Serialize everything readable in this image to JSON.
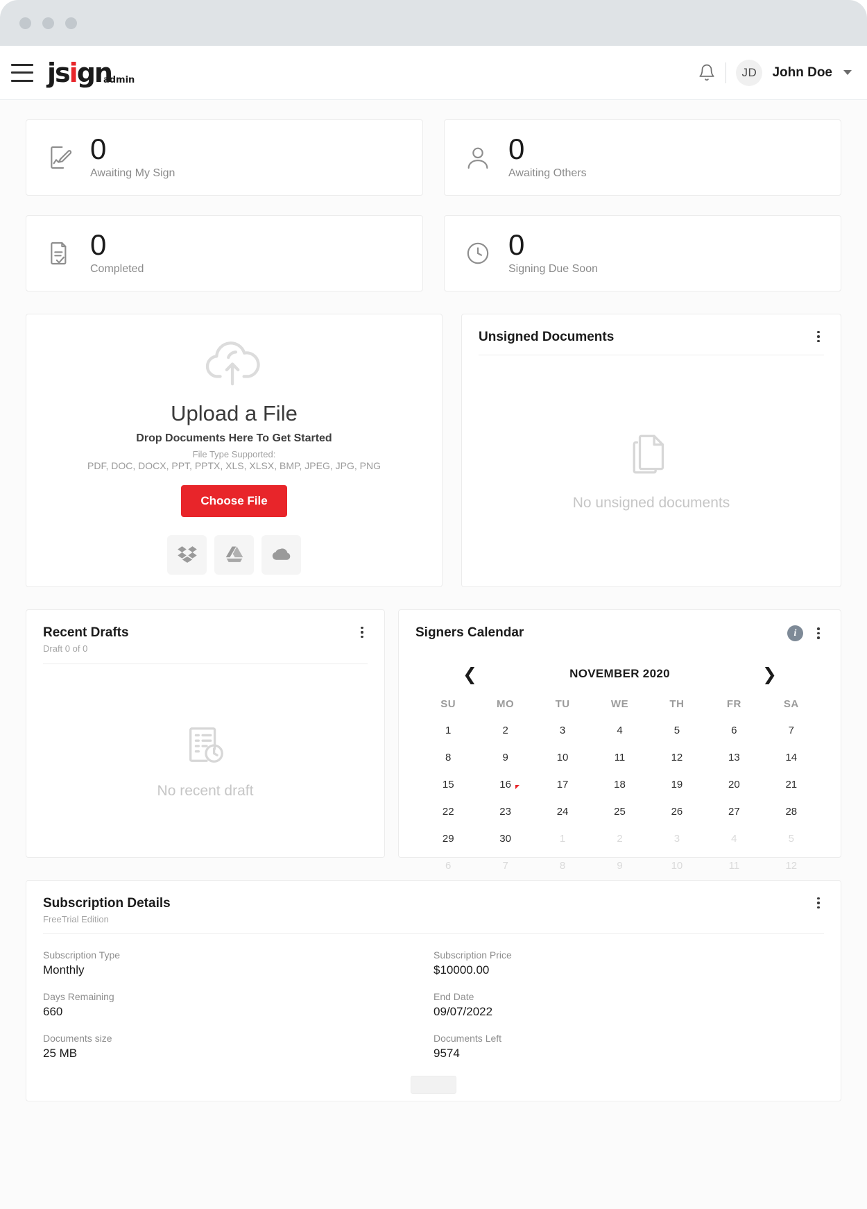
{
  "titlebar": {
    "dots": 3
  },
  "header": {
    "menu_icon": "hamburger-icon",
    "logo": {
      "part1": "js",
      "part2": "i",
      "part3": "gn",
      "suffix": "admin"
    },
    "bell_icon": "notification-bell-icon",
    "avatar_initials": "JD",
    "username": "John Doe",
    "caret_icon": "chevron-down-icon"
  },
  "stats": [
    {
      "icon": "document-sign-icon",
      "value": "0",
      "label": "Awaiting My Sign"
    },
    {
      "icon": "person-icon",
      "value": "0",
      "label": "Awaiting Others"
    },
    {
      "icon": "document-check-icon",
      "value": "0",
      "label": "Completed"
    },
    {
      "icon": "clock-icon",
      "value": "0",
      "label": "Signing Due Soon"
    }
  ],
  "upload": {
    "icon": "cloud-upload-icon",
    "title": "Upload a File",
    "subtitle": "Drop Documents Here To Get Started",
    "filetype_label": "File Type Supported:",
    "filetypes": "PDF, DOC, DOCX, PPT, PPTX, XLS, XLSX, BMP, JPEG, JPG, PNG",
    "button": "Choose File",
    "cloud_services": [
      {
        "name": "dropbox-icon",
        "label": "Dropbox"
      },
      {
        "name": "google-drive-icon",
        "label": "Google Drive"
      },
      {
        "name": "onedrive-icon",
        "label": "OneDrive"
      }
    ]
  },
  "unsigned": {
    "title": "Unsigned Documents",
    "menu_icon": "kebab-menu-icon",
    "empty_icon": "documents-stack-icon",
    "empty_text": "No unsigned documents"
  },
  "drafts": {
    "title": "Recent Drafts",
    "subtitle": "Draft 0 of 0",
    "menu_icon": "kebab-menu-icon",
    "empty_icon": "draft-clock-icon",
    "empty_text": "No recent draft"
  },
  "calendar": {
    "title": "Signers Calendar",
    "info_icon": "info-icon",
    "menu_icon": "kebab-menu-icon",
    "prev_icon": "chevron-left-icon",
    "next_icon": "chevron-right-icon",
    "month": "NOVEMBER 2020",
    "dow": [
      "SU",
      "MO",
      "TU",
      "WE",
      "TH",
      "FR",
      "SA"
    ],
    "weeks": [
      [
        {
          "d": "1"
        },
        {
          "d": "2"
        },
        {
          "d": "3"
        },
        {
          "d": "4"
        },
        {
          "d": "5"
        },
        {
          "d": "6"
        },
        {
          "d": "7"
        }
      ],
      [
        {
          "d": "8"
        },
        {
          "d": "9"
        },
        {
          "d": "10"
        },
        {
          "d": "11"
        },
        {
          "d": "12"
        },
        {
          "d": "13"
        },
        {
          "d": "14"
        }
      ],
      [
        {
          "d": "15"
        },
        {
          "d": "16",
          "flag": true
        },
        {
          "d": "17"
        },
        {
          "d": "18"
        },
        {
          "d": "19"
        },
        {
          "d": "20"
        },
        {
          "d": "21"
        }
      ],
      [
        {
          "d": "22"
        },
        {
          "d": "23"
        },
        {
          "d": "24"
        },
        {
          "d": "25"
        },
        {
          "d": "26"
        },
        {
          "d": "27"
        },
        {
          "d": "28"
        }
      ],
      [
        {
          "d": "29"
        },
        {
          "d": "30"
        },
        {
          "d": "1",
          "mut": true
        },
        {
          "d": "2",
          "mut": true
        },
        {
          "d": "3",
          "mut": true
        },
        {
          "d": "4",
          "mut": true
        },
        {
          "d": "5",
          "mut": true
        }
      ],
      [
        {
          "d": "6",
          "mut": true
        },
        {
          "d": "7",
          "mut": true
        },
        {
          "d": "8",
          "mut": true
        },
        {
          "d": "9",
          "mut": true
        },
        {
          "d": "10",
          "mut": true
        },
        {
          "d": "11",
          "mut": true
        },
        {
          "d": "12",
          "mut": true
        }
      ]
    ]
  },
  "subscription": {
    "title": "Subscription Details",
    "edition": "FreeTrial Edition",
    "menu_icon": "kebab-menu-icon",
    "fields": [
      {
        "key": "Subscription Type",
        "value": "Monthly"
      },
      {
        "key": "Subscription Price",
        "value": "$10000.00"
      },
      {
        "key": "Days Remaining",
        "value": "660"
      },
      {
        "key": "End Date",
        "value": "09/07/2022"
      },
      {
        "key": "Documents size",
        "value": "25 MB"
      },
      {
        "key": "Documents Left",
        "value": "9574"
      }
    ]
  },
  "colors": {
    "accent_red": "#e8252a",
    "titlebar": "#dfe3e6",
    "page_bg": "#fbfbfb",
    "text_primary": "#1b1b1b",
    "text_muted": "#8e8e8e"
  }
}
